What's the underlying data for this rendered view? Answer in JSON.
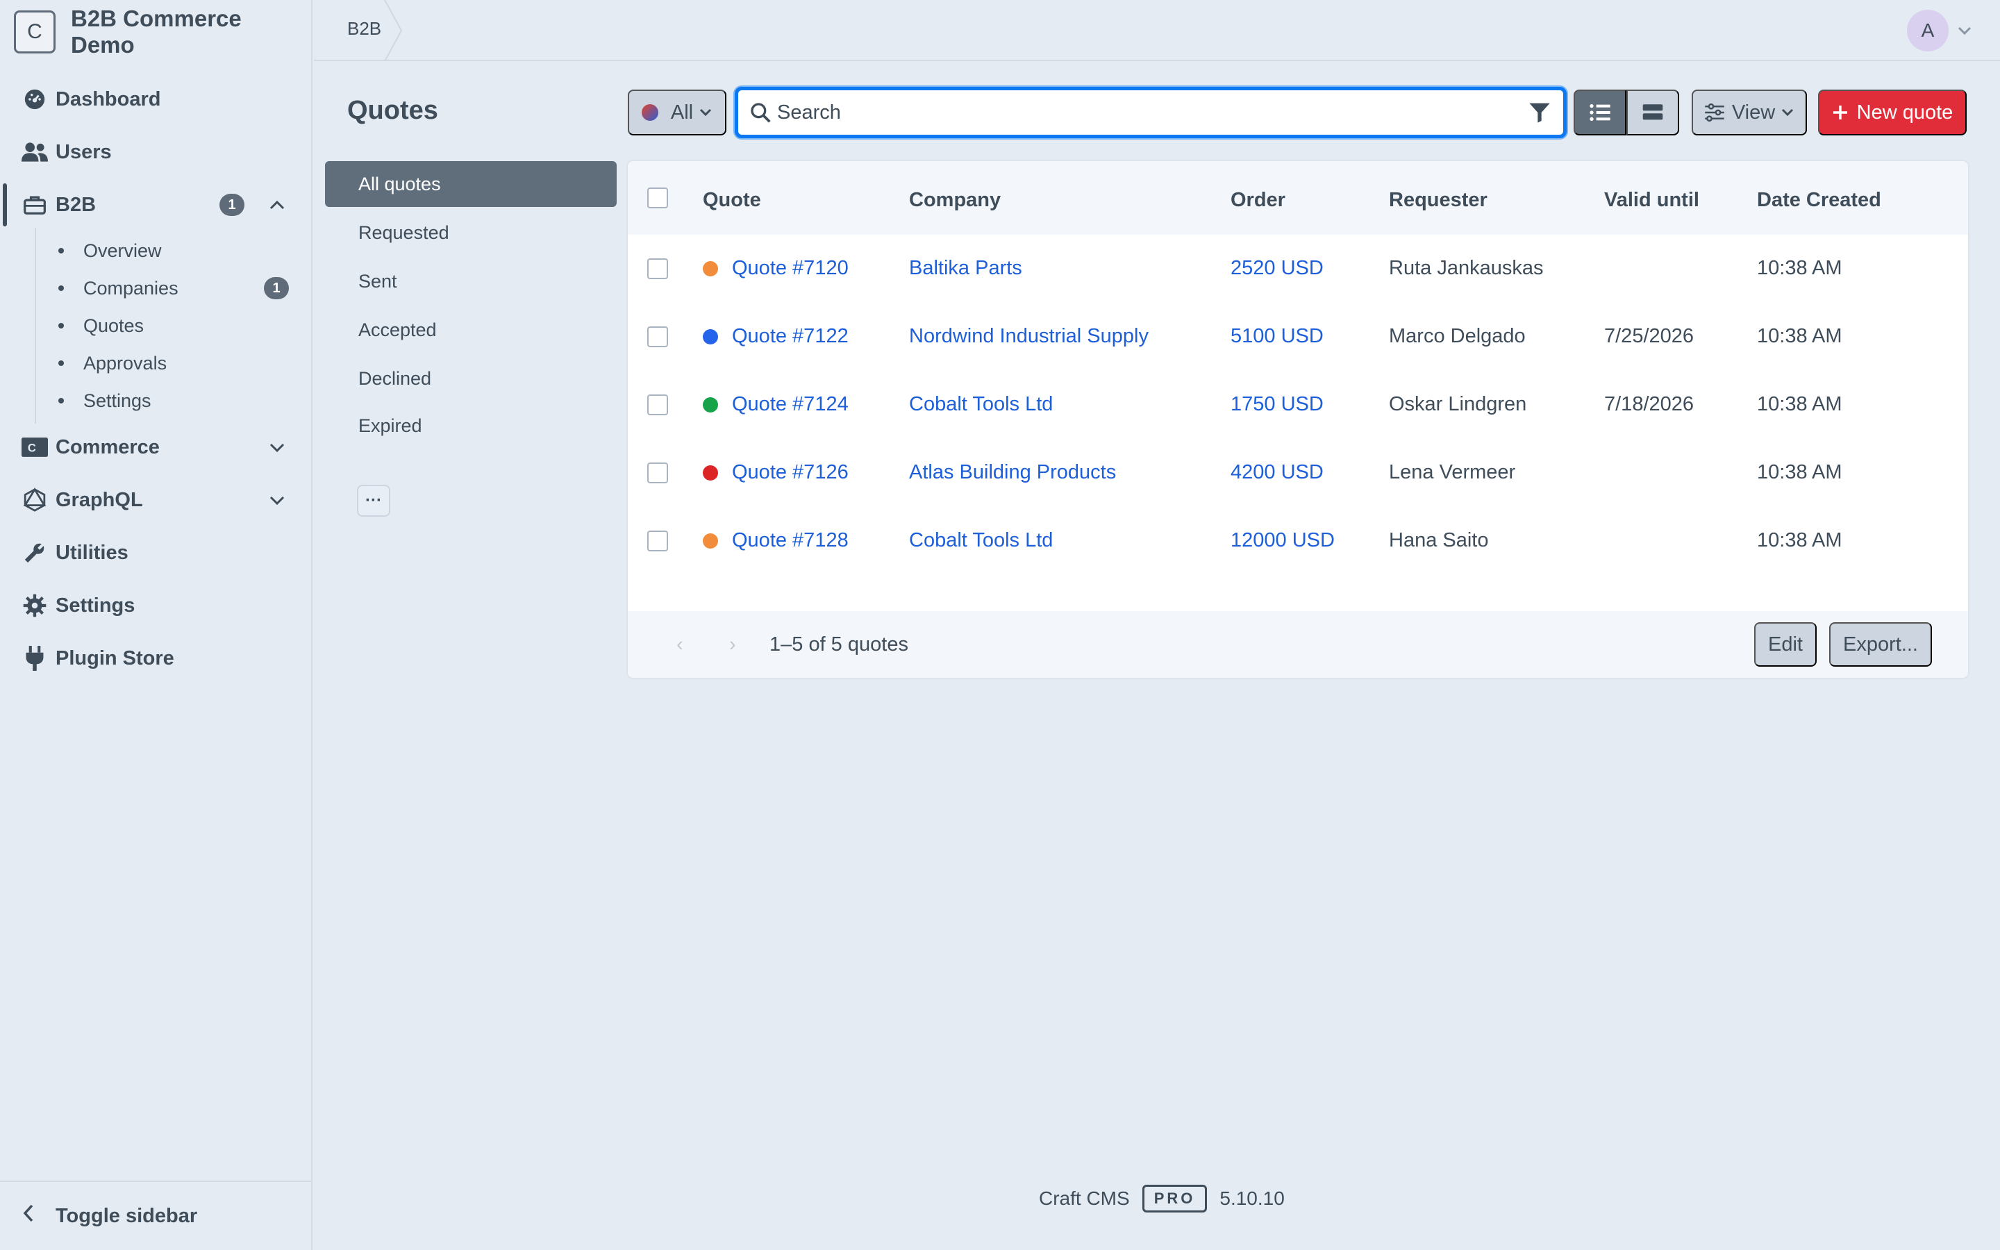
{
  "site": {
    "icon_letter": "C",
    "name": "B2B Commerce Demo"
  },
  "sidebar": {
    "items": [
      {
        "label": "Dashboard"
      },
      {
        "label": "Users"
      },
      {
        "label": "B2B",
        "badge": "1"
      },
      {
        "label": "Commerce"
      },
      {
        "label": "GraphQL"
      },
      {
        "label": "Utilities"
      },
      {
        "label": "Settings"
      },
      {
        "label": "Plugin Store"
      }
    ],
    "b2b_subitems": [
      {
        "label": "Overview"
      },
      {
        "label": "Companies",
        "badge": "1"
      },
      {
        "label": "Quotes"
      },
      {
        "label": "Approvals"
      },
      {
        "label": "Settings"
      }
    ],
    "toggle_label": "Toggle sidebar"
  },
  "header": {
    "breadcrumb": "B2B",
    "avatar_letter": "A"
  },
  "page": {
    "title": "Quotes"
  },
  "sources": [
    "All quotes",
    "Requested",
    "Sent",
    "Accepted",
    "Declined",
    "Expired"
  ],
  "more_label": "···",
  "toolbar": {
    "status_label": "All",
    "search_placeholder": "Search",
    "view_label": "View",
    "new_label": "New quote"
  },
  "table": {
    "columns": [
      "Quote",
      "Company",
      "Order",
      "Requester",
      "Valid until",
      "Date Created"
    ],
    "rows": [
      {
        "status_color": "#f18c3a",
        "quote": "Quote #7120",
        "company": "Baltika Parts",
        "order": "2520 USD",
        "requester": "Ruta Jankauskas",
        "valid_until": "",
        "date_created": "10:38 AM"
      },
      {
        "status_color": "#2563eb",
        "quote": "Quote #7122",
        "company": "Nordwind Industrial Supply",
        "order": "5100 USD",
        "requester": "Marco Delgado",
        "valid_until": "7/25/2026",
        "date_created": "10:38 AM"
      },
      {
        "status_color": "#16a34a",
        "quote": "Quote #7124",
        "company": "Cobalt Tools Ltd",
        "order": "1750 USD",
        "requester": "Oskar Lindgren",
        "valid_until": "7/18/2026",
        "date_created": "10:38 AM"
      },
      {
        "status_color": "#dc2626",
        "quote": "Quote #7126",
        "company": "Atlas Building Products",
        "order": "4200 USD",
        "requester": "Lena Vermeer",
        "valid_until": "",
        "date_created": "10:38 AM"
      },
      {
        "status_color": "#f18c3a",
        "quote": "Quote #7128",
        "company": "Cobalt Tools Ltd",
        "order": "12000 USD",
        "requester": "Hana Saito",
        "valid_until": "",
        "date_created": "10:38 AM"
      }
    ]
  },
  "pagination": {
    "text": "1–5 of 5 quotes",
    "prev": "‹",
    "next": "›"
  },
  "footer_actions": {
    "edit": "Edit",
    "export": "Export..."
  },
  "footer": {
    "product": "Craft CMS",
    "edition": "PRO",
    "version": "5.10.10"
  },
  "colors": {
    "accent": "#e12d39",
    "link": "#1d5fd8",
    "focus": "#0d78f2"
  }
}
